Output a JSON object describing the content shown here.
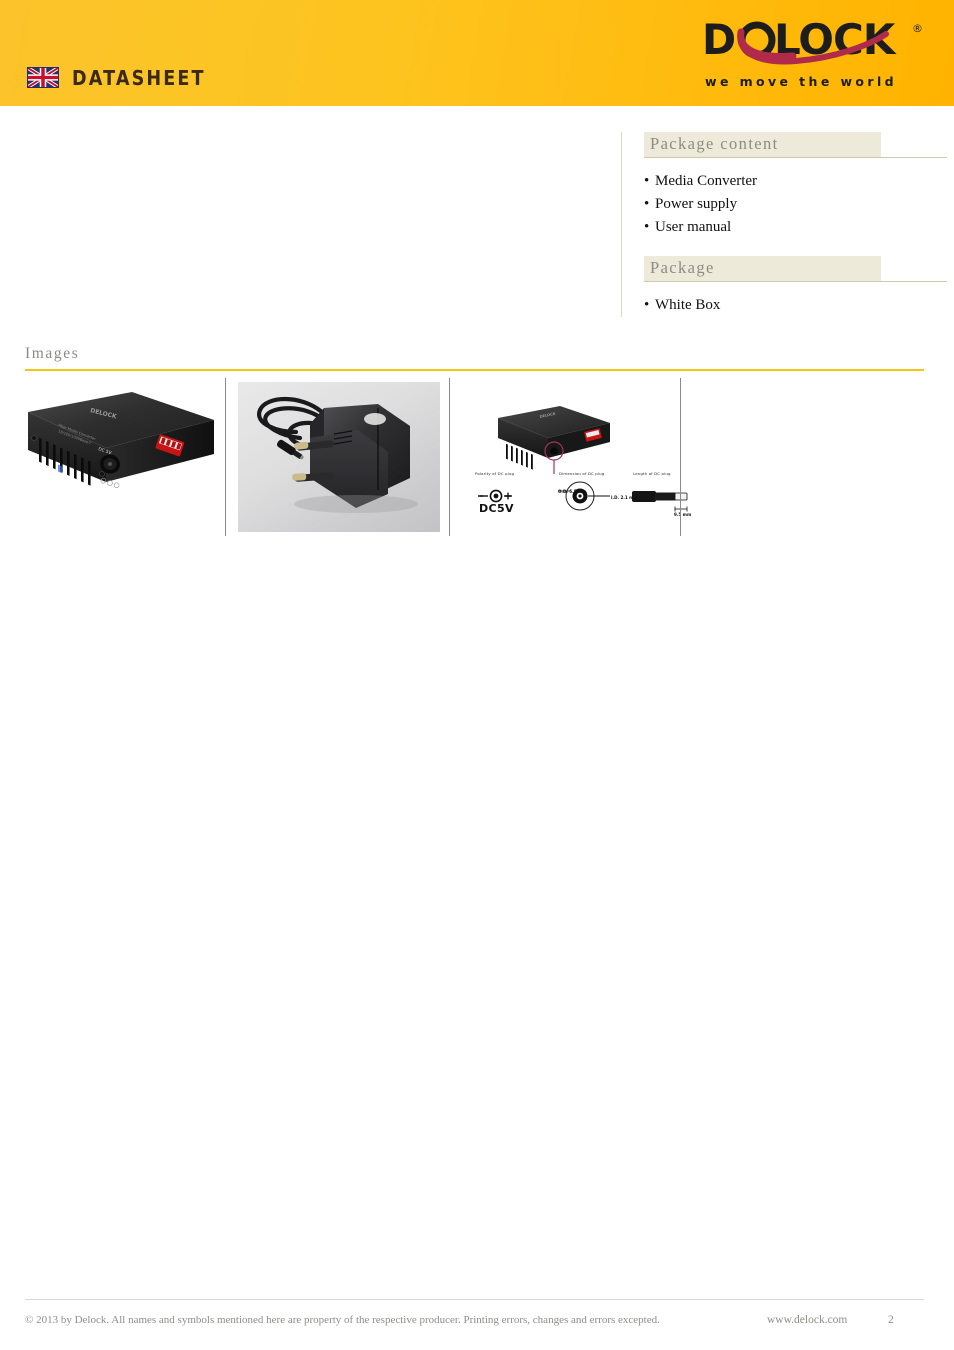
{
  "header": {
    "flag_icon": "uk-flag-icon",
    "datasheet_label": "DATASHEET",
    "brand": "DELOCK",
    "brand_registered": "®",
    "tagline": "we move the world",
    "band_color": "#ffc107",
    "brand_color": "#1d1d1d",
    "swoosh_color": "#b02a4a"
  },
  "side_panel": {
    "sections": [
      {
        "title": "Package content",
        "items": [
          "Media Converter",
          "Power supply",
          "User manual"
        ]
      },
      {
        "title": "Package",
        "items": [
          "White Box"
        ]
      }
    ],
    "band_color": "#eeead9",
    "title_color": "#8c8c86"
  },
  "images_section": {
    "title": "Images",
    "rule_color": "#f5c518",
    "items": [
      {
        "name": "media-converter-photo",
        "alt": "Black media converter with ventilation slots, DC 5V jack and red DIP switch",
        "label_dc": "DC 5V"
      },
      {
        "name": "power-supply-photo",
        "alt": "Black EU plug power supply with coiled DC cable on grey background"
      },
      {
        "name": "dc-plug-diagram",
        "alt": "Technical diagram of DC plug polarity, dimension and length",
        "labels": {
          "polarity": "Polarity of DC plug",
          "dimension": "Dimension of DC plug",
          "length": "Length of DC plug",
          "voltage": "DC5V",
          "outer_diameter": "O.D.  5.5 mm",
          "inner_diameter": "I.D.  2.1 mm",
          "plug_length": "9.5 mm",
          "minus": "−",
          "plus": "+"
        }
      }
    ]
  },
  "footer": {
    "copyright": "© 2013 by Delock. All names and symbols mentioned here are property of the respective producer. Printing errors, changes and errors excepted.",
    "url": "www.delock.com",
    "page_number": "2",
    "text_color": "#8d8d88"
  }
}
